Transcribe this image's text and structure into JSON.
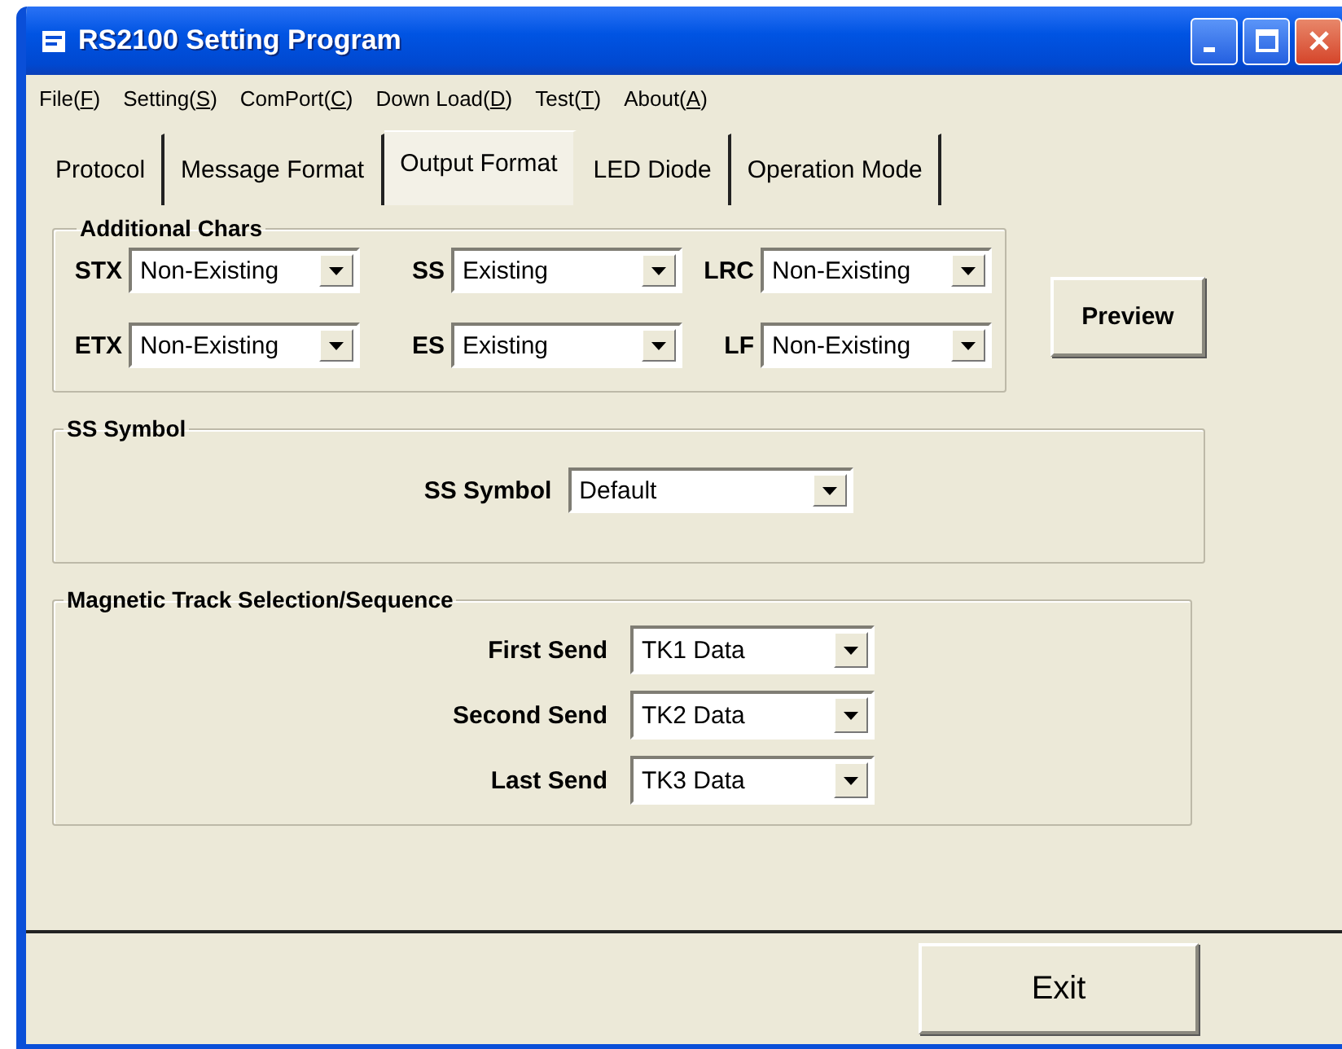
{
  "window": {
    "title": "RS2100 Setting Program"
  },
  "menu": [
    {
      "text": "File(",
      "access_key": "F",
      "end": ")"
    },
    {
      "text": "Setting(",
      "access_key": "S",
      "end": ")"
    },
    {
      "text": "ComPort(",
      "access_key": "C",
      "end": ")"
    },
    {
      "text": "Down Load(",
      "access_key": "D",
      "end": ")"
    },
    {
      "text": "Test(",
      "access_key": "T",
      "end": ")"
    },
    {
      "text": "About(",
      "access_key": "A",
      "end": ")"
    }
  ],
  "tabs": [
    {
      "label": "Protocol",
      "selected": false
    },
    {
      "label": "Message Format",
      "selected": false
    },
    {
      "label": "Output Format",
      "selected": true
    },
    {
      "label": "LED Diode",
      "selected": false
    },
    {
      "label": "Operation Mode",
      "selected": false
    }
  ],
  "additional_chars": {
    "title": "Additional Chars",
    "fields": [
      {
        "label": "STX",
        "value": "Non-Existing"
      },
      {
        "label": "SS",
        "value": "Existing"
      },
      {
        "label": "LRC",
        "value": "Non-Existing"
      },
      {
        "label": "ETX",
        "value": "Non-Existing"
      },
      {
        "label": "ES",
        "value": "Existing"
      },
      {
        "label": "LF",
        "value": "Non-Existing"
      }
    ]
  },
  "preview_button": "Preview",
  "ss_symbol": {
    "title": "SS Symbol",
    "label": "SS Symbol",
    "value": "Default"
  },
  "track_sequence": {
    "title": "Magnetic Track Selection/Sequence",
    "rows": [
      {
        "label": "First Send",
        "value": "TK1 Data"
      },
      {
        "label": "Second Send",
        "value": "TK2 Data"
      },
      {
        "label": "Last Send",
        "value": "TK3 Data"
      }
    ]
  },
  "exit_button": "Exit"
}
